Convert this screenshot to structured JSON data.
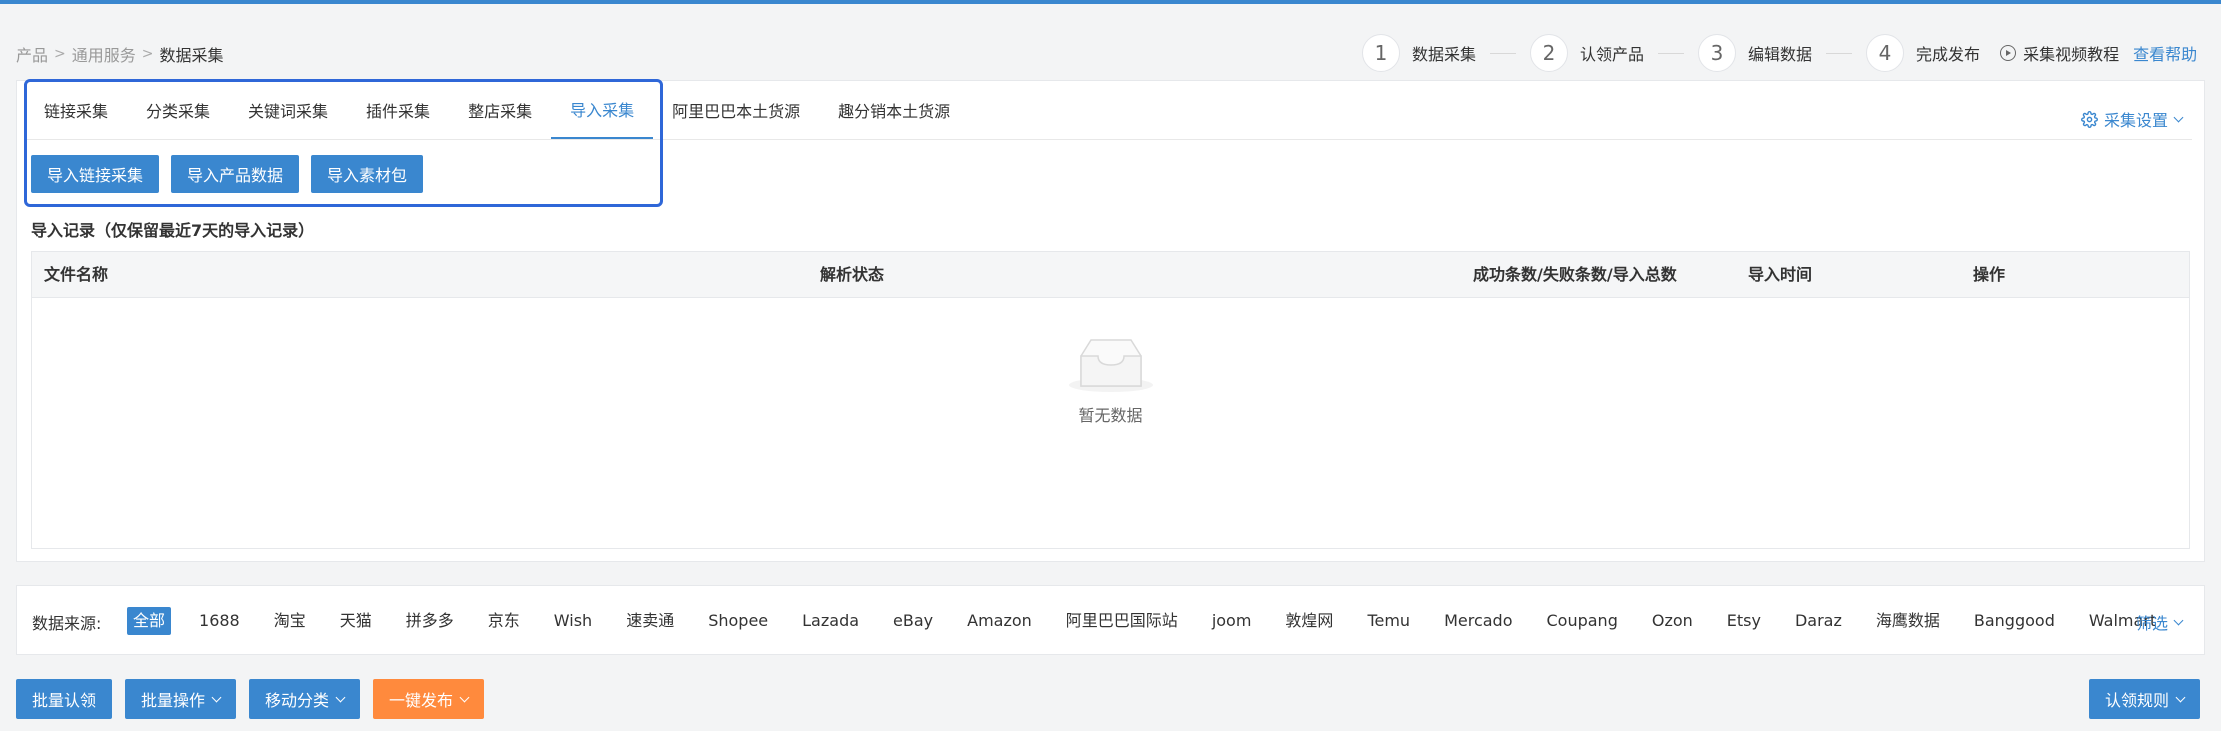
{
  "breadcrumb": [
    "产品",
    "通用服务",
    "数据采集"
  ],
  "steps": [
    {
      "num": "1",
      "label": "数据采集"
    },
    {
      "num": "2",
      "label": "认领产品"
    },
    {
      "num": "3",
      "label": "编辑数据"
    },
    {
      "num": "4",
      "label": "完成发布"
    }
  ],
  "video_tutorial": "采集视频教程",
  "help": "查看帮助",
  "tabs": [
    "链接采集",
    "分类采集",
    "关键词采集",
    "插件采集",
    "整店采集",
    "导入采集",
    "阿里巴巴本土货源",
    "趣分销本土货源"
  ],
  "active_tab": "导入采集",
  "collect_settings": "采集设置",
  "import_buttons": [
    "导入链接采集",
    "导入产品数据",
    "导入素材包"
  ],
  "records_title": "导入记录（仅保留最近7天的导入记录）",
  "table": {
    "headers": [
      "文件名称",
      "解析状态",
      "成功条数/失败条数/导入总数",
      "导入时间",
      "操作"
    ],
    "empty_text": "暂无数据"
  },
  "filter": {
    "label": "数据来源:",
    "sources": [
      "全部",
      "1688",
      "淘宝",
      "天猫",
      "拼多多",
      "京东",
      "Wish",
      "速卖通",
      "Shopee",
      "Lazada",
      "eBay",
      "Amazon",
      "阿里巴巴国际站",
      "joom",
      "敦煌网",
      "Temu",
      "Mercado",
      "Coupang",
      "Ozon",
      "Etsy",
      "Daraz",
      "海鹰数据",
      "Banggood",
      "Walmart"
    ],
    "active": "全部",
    "filter_link": "筛选"
  },
  "actions": {
    "batch_claim": "批量认领",
    "batch_ops": "批量操作",
    "move_category": "移动分类",
    "one_click_publish": "一键发布",
    "claim_rules": "认领规则"
  },
  "colors": {
    "accent": "#3a87cf",
    "orange": "#ff8a3d",
    "highlight": "#2f67d8"
  }
}
